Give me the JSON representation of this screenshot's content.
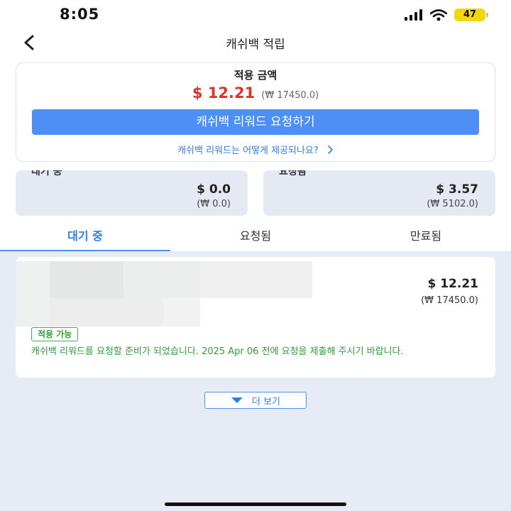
{
  "status_bar": {
    "time": "8:05",
    "battery": "47"
  },
  "header": {
    "title": "캐쉬백 적립"
  },
  "summary": {
    "label": "적용 금액",
    "amount_usd": "$ 12.21",
    "amount_krw": "(₩ 17450.0)",
    "request_button": "캐쉬백 리워드 요청하기",
    "help_link": "캐쉬백 리워드는 어떻게 제공되나요?"
  },
  "stats": {
    "pending": {
      "label": "대기 중",
      "usd": "$ 0.0",
      "krw": "(₩ 0.0)"
    },
    "requested": {
      "label": "요청됨",
      "usd": "$ 3.57",
      "krw": "(₩ 5102.0)"
    }
  },
  "tabs": [
    {
      "label": "대기 중",
      "active": true
    },
    {
      "label": "요청됨",
      "active": false
    },
    {
      "label": "만료됨",
      "active": false
    }
  ],
  "rewards": [
    {
      "usd": "$ 12.21",
      "krw": "(₩ 17450.0)",
      "badge": "적용 가능",
      "message": "캐쉬백 리워드를 요청할 준비가 되었습니다. 2025 Apr 06 전에 요청을 제출해 주시기 바랍니다."
    }
  ],
  "more_button": "더 보기",
  "colors": {
    "accent": "#4d8ff5",
    "link": "#2f7ee6",
    "price": "#e0312b",
    "success": "#2f9e3b"
  },
  "icons": {
    "back": "chevron-left-icon",
    "help": "chevron-right-icon",
    "more": "caret-down-icon"
  }
}
